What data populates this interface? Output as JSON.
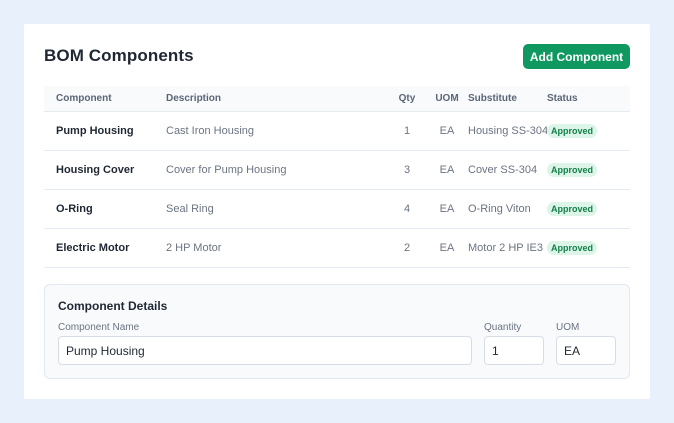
{
  "header": {
    "title": "BOM Components",
    "add_button": "Add Component"
  },
  "table": {
    "columns": [
      "Component",
      "Description",
      "Qty",
      "UOM",
      "Substitute",
      "Status"
    ],
    "rows": [
      {
        "component": "Pump Housing",
        "description": "Cast Iron Housing",
        "qty": "1",
        "uom": "EA",
        "substitute": "Housing SS-304",
        "status": "Approved"
      },
      {
        "component": "Housing Cover",
        "description": "Cover for Pump Housing",
        "qty": "3",
        "uom": "EA",
        "substitute": "Cover SS-304",
        "status": "Approved"
      },
      {
        "component": "O-Ring",
        "description": "Seal Ring",
        "qty": "4",
        "uom": "EA",
        "substitute": "O-Ring Viton",
        "status": "Approved"
      },
      {
        "component": "Electric Motor",
        "description": "2 HP Motor",
        "qty": "2",
        "uom": "EA",
        "substitute": "Motor 2 HP IE3",
        "status": "Approved"
      }
    ]
  },
  "details": {
    "title": "Component Details",
    "name_label": "Component Name",
    "name_value": "Pump Housing",
    "qty_label": "Quantity",
    "qty_value": "1",
    "uom_label": "UOM",
    "uom_value": "EA"
  },
  "colors": {
    "accent": "#0f9960",
    "badge_bg": "#dcf5e8",
    "badge_text": "#14804a",
    "page_bg": "#e8f1fb"
  }
}
